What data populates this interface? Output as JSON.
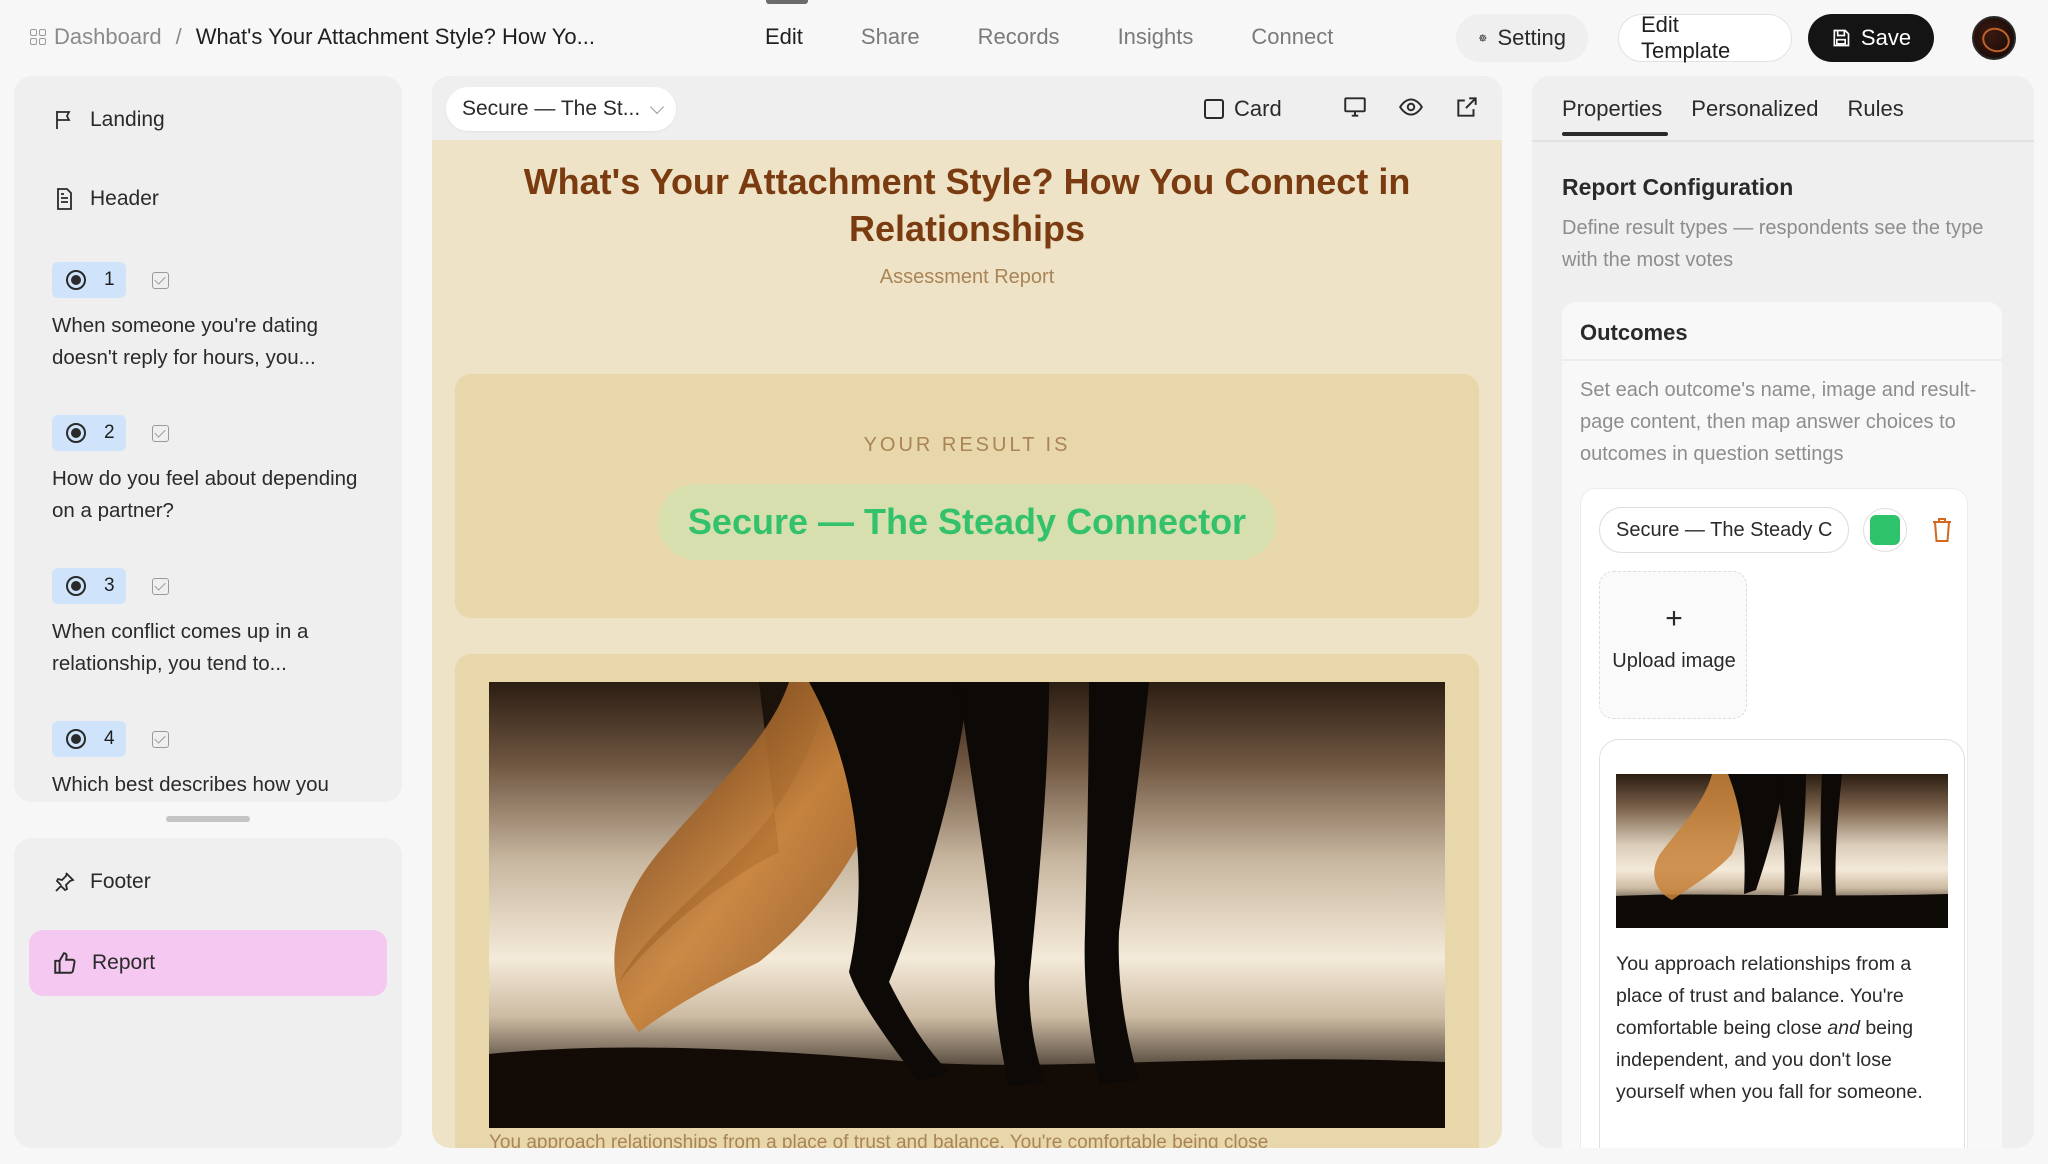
{
  "topbar": {
    "dashboard_label": "Dashboard",
    "separator": "/",
    "current_title": "What's Your Attachment Style? How Yo...",
    "tabs": [
      {
        "label": "Edit",
        "active": true
      },
      {
        "label": "Share",
        "active": false
      },
      {
        "label": "Records",
        "active": false
      },
      {
        "label": "Insights",
        "active": false
      },
      {
        "label": "Connect",
        "active": false
      }
    ],
    "setting_label": "Setting",
    "edit_template_label": "Edit Template",
    "save_label": "Save"
  },
  "sidebar": {
    "landing_label": "Landing",
    "header_label": "Header",
    "questions": [
      {
        "number": "1",
        "text": "When someone you're dating doesn't reply for hours, you..."
      },
      {
        "number": "2",
        "text": "How do you feel about depending on a partner?"
      },
      {
        "number": "3",
        "text": "When conflict comes up in a relationship, you tend to..."
      },
      {
        "number": "4",
        "text": "Which best describes how you"
      }
    ],
    "footer_label": "Footer",
    "report_label": "Report"
  },
  "canvas": {
    "variant_select": "Secure — The St...",
    "card_label": "Card",
    "title": "What's Your Attachment Style? How You Connect in Relationships",
    "subtitle": "Assessment Report",
    "result_label": "YOUR RESULT IS",
    "result_value": "Secure — The Steady Connector",
    "description_peek": "You approach relationships from a place of trust and balance. You're comfortable being close"
  },
  "properties": {
    "tabs": [
      {
        "label": "Properties",
        "active": true
      },
      {
        "label": "Personalized",
        "active": false
      },
      {
        "label": "Rules",
        "active": false
      }
    ],
    "config_title": "Report Configuration",
    "config_desc": "Define result types — respondents see the type with the most votes",
    "outcomes_title": "Outcomes",
    "outcomes_desc": "Set each outcome's name, image and result-page content, then map answer choices to outcomes in question settings",
    "outcome": {
      "name_value": "Secure — The Steady Connector",
      "color": "#2ec36a",
      "upload_plus": "+",
      "upload_label": "Upload image",
      "preview_text_1": "You approach relationships from a place of trust and balance. You're comfortable being close ",
      "preview_text_em": "and",
      "preview_text_2": " being independent, and you don't lose yourself when you fall for someone."
    }
  },
  "colors": {
    "accent_pink": "#f5c8f1",
    "question_pill": "#cfe4fb",
    "title_brown": "#7a3b10",
    "result_green": "#33c26b",
    "canvas_bg": "#efe3c7"
  }
}
